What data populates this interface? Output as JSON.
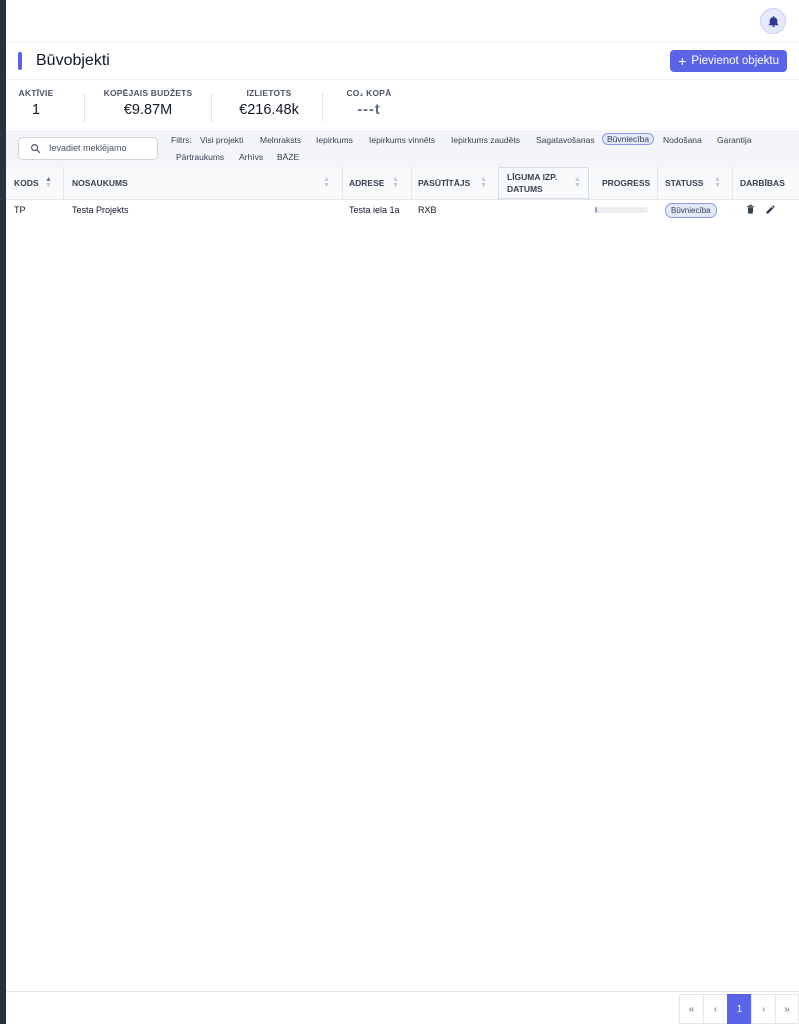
{
  "header": {
    "title": "Būvobjekti",
    "add_button_label": "Pievienot objektu",
    "notifications_icon": "bell-icon"
  },
  "stats": [
    {
      "label": "AKTĪVIE",
      "value": "1"
    },
    {
      "label": "KOPĒJAIS BUDŽETS",
      "value": "€9.87M"
    },
    {
      "label": "IZLIETOTS",
      "value": "€216.48k"
    },
    {
      "label": "CO₂ KOPĀ",
      "value": "---t"
    }
  ],
  "search": {
    "placeholder": "Ievadiet meklējamo"
  },
  "filters": {
    "label": "Filtrs:",
    "items": [
      "Visi projekti",
      "Melnraksts",
      "Iepirkums",
      "Iepirkums vinnēts",
      "Iepirkums zaudēts",
      "Sagatavošanas",
      "Būvniecība",
      "Nodošana",
      "Garantija",
      "Pārtraukums",
      "Arhīvs",
      "BĀZE"
    ],
    "active": "Būvniecība"
  },
  "table": {
    "columns": [
      "KODS",
      "NOSAUKUMS",
      "ADRESE",
      "PASŪTĪTĀJS",
      "LĪGUMA IZP. DATUMS",
      "PROGRESS",
      "STATUSS",
      "DARBĪBAS"
    ],
    "rows": [
      {
        "kods": "TP",
        "nosaukums": "Testa Projekts",
        "adrese": "Testa iela 1a",
        "pasutitajs": "RXB",
        "liguma_datums": "",
        "progress": 0.03,
        "statuss": "Būvniecība"
      }
    ]
  },
  "pagination": {
    "first": "«",
    "prev": "‹",
    "current": "1",
    "next": "›",
    "last": "»"
  },
  "colors": {
    "accent": "#5b63e6",
    "badge_bg": "#e3e8fb"
  }
}
